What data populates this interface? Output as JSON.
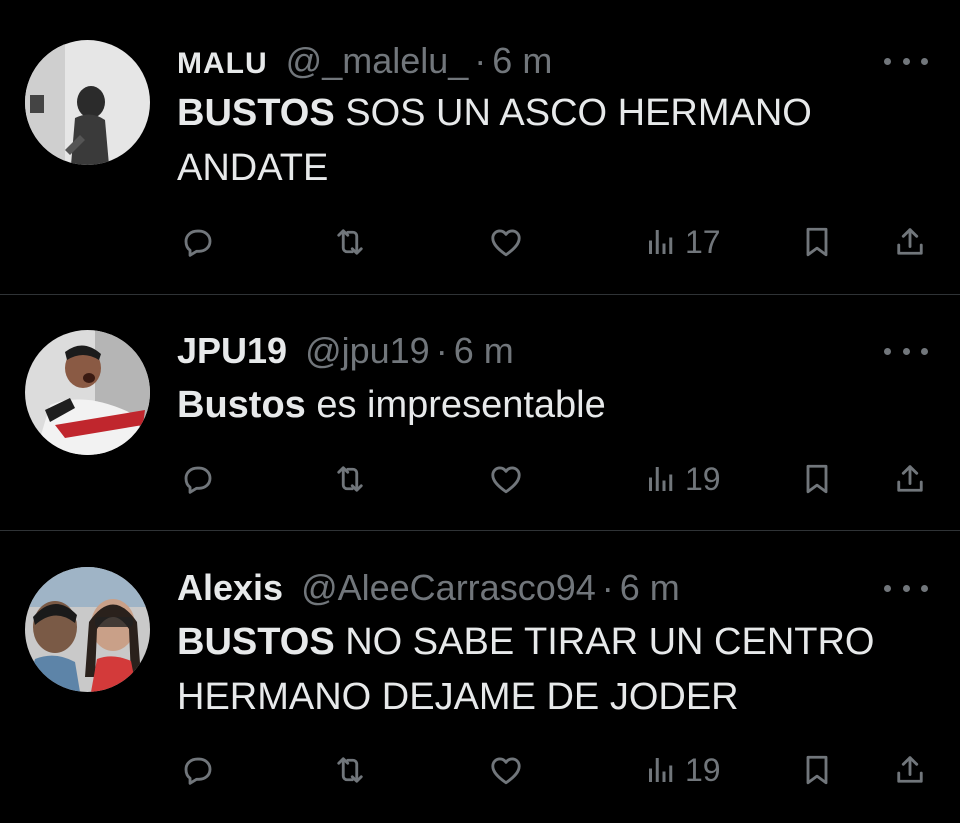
{
  "tweets": [
    {
      "display_name": "MALU",
      "handle": "@_malelu_",
      "separator": "·",
      "time": "6 m",
      "text_bold": "BUSTOS",
      "text_rest": " SOS UN ASCO HERMANO ANDATE",
      "views": "17",
      "avatar_colors": [
        "#e8e8e8",
        "#2a2a2a"
      ]
    },
    {
      "display_name": "JPU19",
      "handle": "@jpu19",
      "separator": "·",
      "time": "6 m",
      "text_bold": "Bustos",
      "text_rest": " es impresentable",
      "views": "19",
      "avatar_colors": [
        "#d8d8d8",
        "#c0262d"
      ]
    },
    {
      "display_name": "Alexis",
      "handle": "@AleeCarrasco94",
      "separator": "·",
      "time": "6 m",
      "text_bold": "BUSTOS",
      "text_rest": " NO SABE TIRAR UN CENTRO HERMANO DEJAME DE JODER",
      "views": "19",
      "avatar_colors": [
        "#b8b8b8",
        "#6b8aa8"
      ]
    }
  ],
  "icons": {
    "reply": "reply-icon",
    "retweet": "retweet-icon",
    "like": "like-icon",
    "views": "views-icon",
    "bookmark": "bookmark-icon",
    "share": "share-icon",
    "more": "more-icon"
  },
  "colors": {
    "background": "#000000",
    "text": "#e7e9ea",
    "secondary": "#71767b",
    "divider": "#2f3336"
  }
}
